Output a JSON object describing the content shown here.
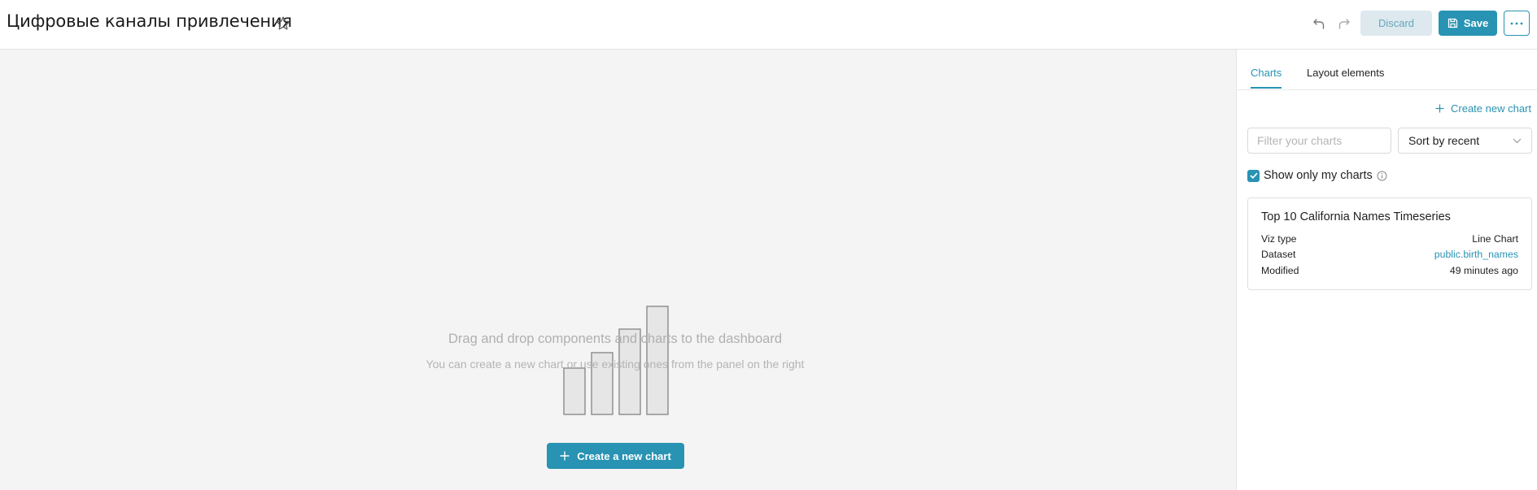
{
  "header": {
    "title": "Цифровые каналы привлечения",
    "discard_label": "Discard",
    "save_label": "Save",
    "icons": [
      "star-icon",
      "undo-icon",
      "redo-icon",
      "save-icon",
      "more-icon"
    ]
  },
  "canvas": {
    "empty_title": "Drag and drop components and charts to the dashboard",
    "empty_subtitle": "You can create a new chart or use existing ones from the panel on the right",
    "create_button_label": "Create a new chart"
  },
  "panel": {
    "tabs": [
      {
        "label": "Charts",
        "active": true
      },
      {
        "label": "Layout elements",
        "active": false
      }
    ],
    "create_new_chart_label": "Create new chart",
    "filter": {
      "placeholder": "Filter your charts",
      "value": ""
    },
    "sort": {
      "selected": "Sort by recent"
    },
    "show_only_mine": {
      "label": "Show only my charts",
      "checked": true
    },
    "charts": [
      {
        "title": "Top 10 California Names Timeseries",
        "rows": [
          {
            "label": "Viz type",
            "value": "Line Chart"
          },
          {
            "label": "Dataset",
            "value": "public.birth_names"
          },
          {
            "label": "Modified",
            "value": "49 minutes ago"
          }
        ]
      }
    ]
  },
  "colors": {
    "accent": "#2893b3",
    "discard_bg": "#dde9ee",
    "canvas_bg": "#f4f4f4"
  }
}
